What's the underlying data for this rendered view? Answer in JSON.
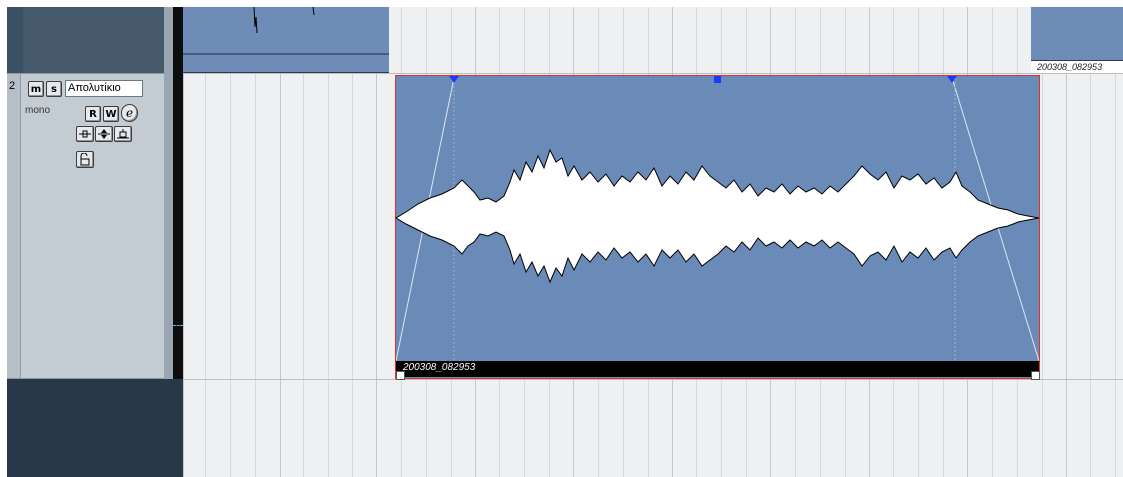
{
  "track": {
    "number": "2",
    "mute_label": "m",
    "solo_label": "s",
    "name": "Απολυτίκιο",
    "channel_mode": "mono",
    "read_label": "R",
    "write_label": "W",
    "edit_label": "e"
  },
  "events": {
    "main_event_name": "200308_082953",
    "top_right_event_name": "200308_082953"
  },
  "colors": {
    "event_fill": "#6a8bb8",
    "event_selected_border": "#e03030",
    "track_panel": "#c4ccd3",
    "arrange_background": "#eef0f2",
    "handle_blue": "#1d3bff"
  },
  "icons": {
    "monitor": "monitor-icon",
    "input": "input-icon",
    "insert": "insert-icon",
    "lock": "lock-icon"
  }
}
